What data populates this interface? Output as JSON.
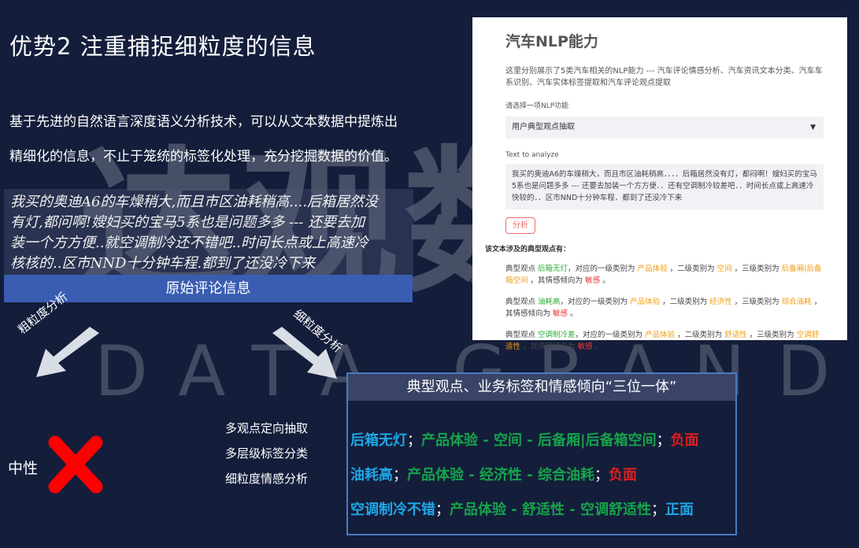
{
  "title": "优势2  注重捕捉细粒度的信息",
  "description": {
    "line1": "基于先进的自然语言深度语义分析技术，可以从文本数据中提炼出",
    "line2": "精细化的信息，不止于笼统的标签化处理，充分挖掘数据的价值。"
  },
  "watermark": {
    "cn": "达观数据",
    "en": "DATA GRAND"
  },
  "original_comment": {
    "lines": [
      "我买的奥迪A6的车燥稍大,而且市区油耗稍高....后箱居然没",
      "有灯,都问啊!嫂妇买的宝马5系也是问题多多 --- 还要去加",
      "装一个方方便..就空调制冷还不错吧..时间长点或上高速冷",
      "核核的..区市NND十分钟车程.都到了还没冷下来"
    ],
    "label": "原始评论信息"
  },
  "arrows": {
    "coarse": "粗粒度分析",
    "fine": "细粒度分析"
  },
  "capabilities": [
    "多观点定向抽取",
    "多层级标签分类",
    "细粒度情感分析"
  ],
  "neutral_label": "中性",
  "icons": {
    "cross": "cross-icon",
    "caret": "caret-down-icon"
  },
  "colors": {
    "background": "#141e3b",
    "accent_blue": "#3a5db2",
    "positive": "#1ea7e6",
    "tag": "#16a34a",
    "negative": "#e11d1d"
  },
  "panel": {
    "title": "汽车NLP能力",
    "intro": "这里分别展示了5类汽车相关的NLP能力 --- 汽车评论情感分析、汽车资讯文本分类、汽车车系识别、汽车实体标签提取和汽车评论观点提取",
    "select_label": "请选择一项NLP功能",
    "select_value": "用户典型观点抽取",
    "text_label": "Text to analyze",
    "text_value": "我买的奥迪A6的车燥稍大，而且市区油耗稍高．．．．后箱居然没有灯，都闷啊！嫂妇买的宝马5系也是问题多多 --- 还要去加装一个方方便．．还有空调制冷较差吧．．时间长点或上高速冷快较的．．区市NND十分钟车程．都到了还没冷下来",
    "button": "分析",
    "result_title": "该文本涉及的典型观点有：",
    "items": [
      {
        "p1": "典型观点 ",
        "opinion": "后箱无灯",
        "p2": "，对应的一级类别为 ",
        "cat1": "产品体验",
        "p3": " ，二级类别为 ",
        "cat2": "空间",
        "p4": " ，三级类别为 ",
        "cat3": "后备厢|后备箱空间",
        "p5": " ，其情感倾向为 ",
        "sentiment": "敏感",
        "p6": " 。"
      },
      {
        "p1": "典型观点 ",
        "opinion": "油耗高",
        "p2": "，对应的一级类别为 ",
        "cat1": "产品体验",
        "p3": " ，二级类别为 ",
        "cat2": "经济性",
        "p4": " ，三级类别为 ",
        "cat3": "综合油耗",
        "p5": " ，其情感倾向为 ",
        "sentiment": "敏感",
        "p6": " 。"
      },
      {
        "p1": "典型观点 ",
        "opinion": "空调制冷差",
        "p2": "，对应的一级类别为 ",
        "cat1": "产品体验",
        "p3": " ，二级类别为 ",
        "cat2": "舒适性",
        "p4": " ，三级类别为 ",
        "cat3": "空调舒适性",
        "p5": " ，其情感倾向为 ",
        "sentiment": "敏感",
        "p6": " 。"
      }
    ]
  },
  "result": {
    "header": "典型观点、业务标签和情感倾向“三位一体”",
    "rows": [
      {
        "opinion": "后箱无灯",
        "sep1": "；",
        "tag": "产品体验 - 空间 - 后备厢|后备箱空间",
        "sep2": "；",
        "sentiment": "负面"
      },
      {
        "opinion": "油耗高",
        "sep1": "；",
        "tag": "产品体验 - 经济性 - 综合油耗",
        "sep2": "；",
        "sentiment": "负面"
      },
      {
        "opinion": "空调制冷不错",
        "sep1": "；",
        "tag": "产品体验 - 舒适性 -  空调舒适性",
        "sep2": "；",
        "sentiment": "正面"
      }
    ]
  }
}
